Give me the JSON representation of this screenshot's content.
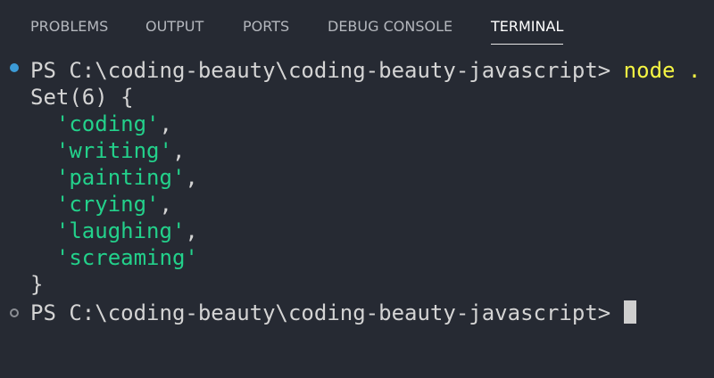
{
  "tabs": [
    {
      "label": "PROBLEMS",
      "active": false
    },
    {
      "label": "OUTPUT",
      "active": false
    },
    {
      "label": "PORTS",
      "active": false
    },
    {
      "label": "DEBUG CONSOLE",
      "active": false
    },
    {
      "label": "TERMINAL",
      "active": true
    }
  ],
  "terminal": {
    "prompt": "PS C:\\coding-beauty\\coding-beauty-javascript> ",
    "command": "node .",
    "set_header": "Set(6) {",
    "set_items": [
      "'coding'",
      "'writing'",
      "'painting'",
      "'crying'",
      "'laughing'",
      "'screaming'"
    ],
    "comma": ",",
    "set_close": "}",
    "prompt_final": "PS C:\\coding-beauty\\coding-beauty-javascript>"
  },
  "colors": {
    "background": "#262a33",
    "string": "#23d18b",
    "command": "#f5f543",
    "success_decoration": "#3c9bd7",
    "default_decoration": "#8b8e94"
  },
  "icons": {
    "success_decoration": "filled-circle-icon",
    "default_decoration": "hollow-circle-icon",
    "cursor": "block-cursor"
  }
}
